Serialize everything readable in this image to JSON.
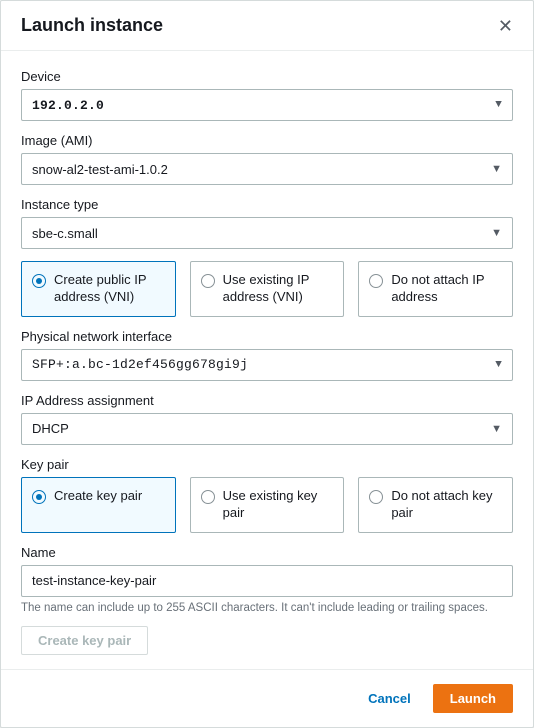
{
  "header": {
    "title": "Launch instance"
  },
  "fields": {
    "device": {
      "label": "Device",
      "value": "192.0.2.0"
    },
    "image": {
      "label": "Image (AMI)",
      "value": "snow-al2-test-ami-1.0.2"
    },
    "instance": {
      "label": "Instance type",
      "value": "sbe-c.small"
    },
    "pni": {
      "label": "Physical network interface",
      "value": "SFP+:a.bc-1d2ef456gg678gi9j"
    },
    "ipassign": {
      "label": "IP Address assignment",
      "value": "DHCP"
    },
    "keypair": {
      "label": "Key pair"
    },
    "name": {
      "label": "Name",
      "value": "test-instance-key-pair",
      "hint": "The name can include up to 255 ASCII characters. It can't include leading or trailing spaces."
    }
  },
  "ip_options": [
    {
      "label": "Create public IP address (VNI)",
      "selected": true
    },
    {
      "label": "Use existing IP address (VNI)",
      "selected": false
    },
    {
      "label": "Do not attach IP address",
      "selected": false
    }
  ],
  "kp_options": [
    {
      "label": "Create key pair",
      "selected": true
    },
    {
      "label": "Use existing key pair",
      "selected": false
    },
    {
      "label": "Do not attach key pair",
      "selected": false
    }
  ],
  "buttons": {
    "create_kp": "Create key pair",
    "cancel": "Cancel",
    "launch": "Launch"
  }
}
